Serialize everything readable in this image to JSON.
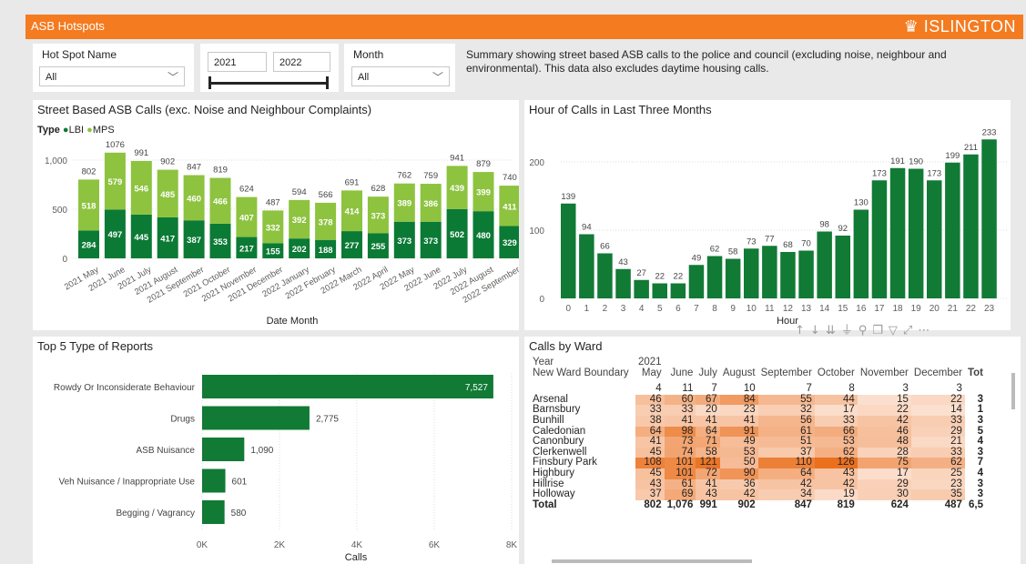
{
  "header": {
    "title": "ASB Hotspots",
    "logo": "ISLINGTON",
    "logo_icon": "crest-icon"
  },
  "filters": {
    "hotspot": {
      "label": "Hot Spot Name",
      "value": "All"
    },
    "year": {
      "from": "2021",
      "to": "2022"
    },
    "month": {
      "label": "Month",
      "value": "All"
    }
  },
  "summary": "Summary showing street based ASB calls to the police and council (excluding noise, neighbour and environmental). This data also excludes daytime housing calls.",
  "chart1": {
    "title": "Street Based ASB Calls (exc. Noise and Neighbour Complaints)",
    "legend_title": "Type"
  },
  "chart2": {
    "title": "Hour of Calls in Last Three Months"
  },
  "chart3": {
    "title": "Top 5 Type of Reports"
  },
  "table": {
    "title": "Calls by Ward"
  },
  "colors": {
    "orange": "#f47b20",
    "lbi": "#0b7a35",
    "mps": "#8dc33f",
    "bar": "#117a35"
  },
  "chart_data": [
    {
      "type": "bar",
      "stacked": true,
      "title": "Street Based ASB Calls (exc. Noise and Neighbour Complaints)",
      "xlabel": "Date Month",
      "ylabel": "",
      "categories": [
        "2021 May",
        "2021 June",
        "2021 July",
        "2021 August",
        "2021 September",
        "2021 October",
        "2021 November",
        "2021 December",
        "2022 January",
        "2022 February",
        "2022 March",
        "2022 April",
        "2022 May",
        "2022 June",
        "2022 July",
        "2022 August",
        "2022 September"
      ],
      "totals": [
        802,
        1076,
        991,
        902,
        847,
        819,
        624,
        487,
        594,
        566,
        691,
        628,
        762,
        759,
        941,
        879,
        740
      ],
      "series": [
        {
          "name": "LBI",
          "values": [
            284,
            497,
            445,
            417,
            387,
            353,
            217,
            155,
            202,
            188,
            277,
            255,
            373,
            373,
            502,
            480,
            329
          ]
        },
        {
          "name": "MPS",
          "values": [
            518,
            579,
            546,
            485,
            460,
            466,
            407,
            332,
            392,
            378,
            414,
            373,
            389,
            386,
            439,
            399,
            411
          ]
        }
      ],
      "yticks": [
        "0",
        "500",
        "1,000"
      ],
      "ylim": [
        0,
        1200
      ],
      "legend": "top-left"
    },
    {
      "type": "bar",
      "title": "Hour of Calls in Last Three Months",
      "xlabel": "Hour",
      "categories": [
        "0",
        "1",
        "2",
        "3",
        "4",
        "5",
        "6",
        "7",
        "8",
        "9",
        "10",
        "11",
        "12",
        "13",
        "14",
        "15",
        "16",
        "17",
        "18",
        "19",
        "20",
        "21",
        "22",
        "23"
      ],
      "values": [
        139,
        94,
        66,
        43,
        27,
        22,
        22,
        49,
        62,
        58,
        73,
        77,
        68,
        70,
        98,
        92,
        130,
        173,
        191,
        190,
        173,
        199,
        211,
        233
      ],
      "yticks": [
        "0",
        "100",
        "200"
      ],
      "ylim": [
        0,
        240
      ]
    },
    {
      "type": "bar",
      "orientation": "horizontal",
      "title": "Top 5 Type of Reports",
      "xlabel": "Calls",
      "categories": [
        "Rowdy Or Inconsiderate Behaviour",
        "Drugs",
        "ASB Nuisance",
        "Veh Nuisance / Inappropriate Use",
        "Begging / Vagrancy"
      ],
      "values": [
        7527,
        2775,
        1090,
        601,
        580
      ],
      "labels": [
        "7,527",
        "2,775",
        "1,090",
        "601",
        "580"
      ],
      "xticks": [
        "0K",
        "2K",
        "4K",
        "6K",
        "8K"
      ],
      "xlim": [
        0,
        8000
      ]
    },
    {
      "type": "table",
      "title": "Calls by Ward",
      "header_year": [
        "Year",
        "2021"
      ],
      "columns": [
        "New Ward Boundary",
        "May",
        "June",
        "July",
        "August",
        "September",
        "October",
        "November",
        "December",
        "Tot"
      ],
      "rows": [
        [
          "",
          "4",
          "11",
          "7",
          "10",
          "7",
          "8",
          "3",
          "3",
          ""
        ],
        [
          "Arsenal",
          "46",
          "60",
          "67",
          "84",
          "55",
          "44",
          "15",
          "22",
          "3"
        ],
        [
          "Barnsbury",
          "33",
          "33",
          "20",
          "23",
          "32",
          "17",
          "22",
          "14",
          "1"
        ],
        [
          "Bunhill",
          "38",
          "41",
          "41",
          "41",
          "56",
          "33",
          "42",
          "33",
          "3"
        ],
        [
          "Caledonian",
          "64",
          "98",
          "64",
          "91",
          "61",
          "66",
          "46",
          "29",
          "5"
        ],
        [
          "Canonbury",
          "41",
          "73",
          "71",
          "49",
          "51",
          "53",
          "48",
          "21",
          "4"
        ],
        [
          "Clerkenwell",
          "45",
          "74",
          "58",
          "53",
          "37",
          "62",
          "28",
          "33",
          "3"
        ],
        [
          "Finsbury Park",
          "108",
          "101",
          "121",
          "50",
          "110",
          "126",
          "75",
          "62",
          "7"
        ],
        [
          "Highbury",
          "45",
          "101",
          "72",
          "90",
          "64",
          "43",
          "17",
          "25",
          "4"
        ],
        [
          "Hillrise",
          "43",
          "61",
          "41",
          "36",
          "42",
          "42",
          "29",
          "23",
          "3"
        ],
        [
          "Holloway",
          "37",
          "69",
          "43",
          "42",
          "34",
          "19",
          "30",
          "35",
          "3"
        ]
      ],
      "total": [
        "Total",
        "802",
        "1,076",
        "991",
        "902",
        "847",
        "819",
        "624",
        "487",
        "6,5"
      ]
    }
  ]
}
